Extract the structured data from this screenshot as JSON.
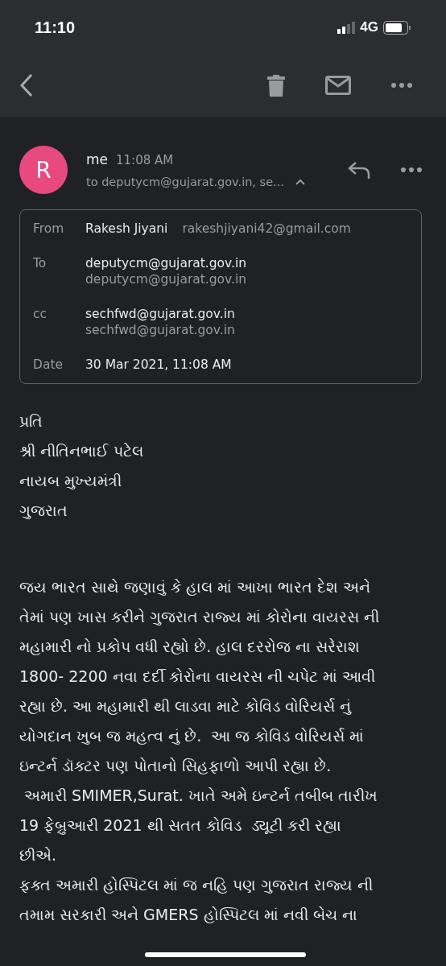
{
  "status_bar": {
    "time": "11:10",
    "network": "4G"
  },
  "message": {
    "avatar_letter": "R",
    "sender": "me",
    "time": "11:08 AM",
    "recipients": "to deputycm@gujarat.gov.in, se...",
    "details_expanded": true
  },
  "details": [
    {
      "label": "From",
      "name": "Rakesh Jiyani",
      "address": "rakeshjiyani42@gmail.com",
      "kind": "inline"
    },
    {
      "label": "To",
      "name": "deputycm@gujarat.gov.in",
      "address": "deputycm@gujarat.gov.in",
      "kind": "stacked"
    },
    {
      "label": "cc",
      "name": "sechfwd@gujarat.gov.in",
      "address": "sechfwd@gujarat.gov.in",
      "kind": "stacked"
    },
    {
      "label": "Date",
      "name": "30 Mar 2021, 11:08 AM",
      "kind": "inline"
    }
  ],
  "salutation": [
    "પ્રતિ",
    "શ્રી નીતિનભાઈ પટેલ",
    "નાયબ મુખ્યમંત્રી",
    "ગુજરાત"
  ],
  "body_lines": [
    "જય ભારત સાથે જણાવું કે હાલ માં આખા ભારત દેશ અને",
    "તેમાં પણ ખાસ કરીને ગુજરાત રાજ્ય માં કોરોના વાયરસ ની",
    "મહામારી નો પ્રકોપ વધી રહ્યો છે. હાલ દરરોજ ના સરેરાશ",
    "1800- 2200 નવા દર્દી કોરોના વાયરસ ની ચપેટ માં આવી",
    "રહ્યા છે. આ મહામારી થી લાડવા માટે કોવિડ વોરિયર્સ નું",
    "યોગદાન ખુબ જ મહત્વ નું છે.  આ જ કોવિડ વોરિયર્સ માં",
    "ઇન્ટર્ન ડૉક્ટર પણ પોતાનો સિહફાળો આપી રહ્યા છે.",
    " અમારી SMIMER,Surat. ખાતે અમે ઇન્ટર્ન તબીબ તારીખ",
    "19 ફેબ્રુઆરી 2021 થી સતત કોવિડ  ડ્યૂટી કરી રહ્યા",
    "છીએ.",
    "ફક્ત અમારી હોસ્પિટલ માં જ નહિ પણ ગુજરાત રાજ્ય ની",
    "તમામ સરકારી અને GMERS હોસ્પિટલ માં નવી બેચ ના"
  ]
}
